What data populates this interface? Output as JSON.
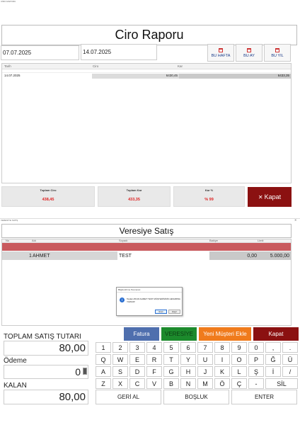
{
  "ciro": {
    "window_title": "CİRO RAPORU",
    "title": "Ciro Raporu",
    "date_start": "07.07.2025",
    "date_end": "14.07.2025",
    "buttons": {
      "week": "BU HAFTA",
      "month": "BU AY",
      "year": "BU YIL"
    },
    "table": {
      "headers": [
        "Tarih",
        "Ciro",
        "Kar"
      ],
      "row": {
        "date": "14.07.2025",
        "ciro": "6430,45",
        "kar": "6433,35"
      }
    },
    "totals": {
      "ciro_label": "Toplam Ciro",
      "ciro_value": "438,45",
      "kar_label": "Toplam Kar",
      "kar_value": "433,35",
      "pct_label": "Kar %",
      "pct_value": "% 99"
    },
    "close": "Kapat",
    "close_icon": "x-icon"
  },
  "veresiye": {
    "window_title": "VERESİYE SATIŞ",
    "title": "Veresiye Satış",
    "table": {
      "headers": {
        "no": "No",
        "adi": "Adı",
        "soyadi": "Soyadı",
        "bakiye": "Bakiye",
        "limit": "Limit"
      },
      "row": {
        "no": "1",
        "adi": "AHMET",
        "soyadi": "TEST",
        "bakiye": "0,00",
        "limit": "5.000,00"
      }
    },
    "dialog": {
      "title": "Bilgilendirme Penceresi",
      "message": "Toplam 80,00 AHMET TEST MÜŞTERİSİNİN HESABINA YAZILDI!",
      "ok": "Evet",
      "no": "Hayır"
    },
    "totals": {
      "toplam_label": "TOPLAM SATIŞ TUTARI",
      "toplam_value": "80,00",
      "odeme_label": "Ödeme",
      "odeme_value": "0",
      "kalan_label": "KALAN",
      "kalan_value": "80,00"
    },
    "actions": {
      "fatura": "Fatura",
      "veresiye": "VERESİYE",
      "yeni": "Yeni Müşteri Ekle",
      "kapat": "Kapat"
    },
    "keyboard": {
      "row1": [
        "1",
        "2",
        "3",
        "4",
        "5",
        "6",
        "7",
        "8",
        "9",
        "0",
        ",",
        "."
      ],
      "row2": [
        "Q",
        "W",
        "E",
        "R",
        "T",
        "Y",
        "U",
        "I",
        "O",
        "P",
        "Ğ",
        "Ü"
      ],
      "row3": [
        "A",
        "S",
        "D",
        "F",
        "G",
        "H",
        "J",
        "K",
        "L",
        "Ş",
        "İ",
        "/"
      ],
      "row4": [
        "Z",
        "X",
        "C",
        "V",
        "B",
        "N",
        "M",
        "Ö",
        "Ç",
        "-",
        "SİL"
      ],
      "row5": [
        "GERİ AL",
        "BOŞLUK",
        "ENTER"
      ]
    },
    "colors": {
      "fatura": "#4f6fae",
      "veresiye": "#1c8a2c",
      "yeni": "#f07b1c",
      "kapat": "#8b1111",
      "row_red": "#c95a5e"
    }
  }
}
